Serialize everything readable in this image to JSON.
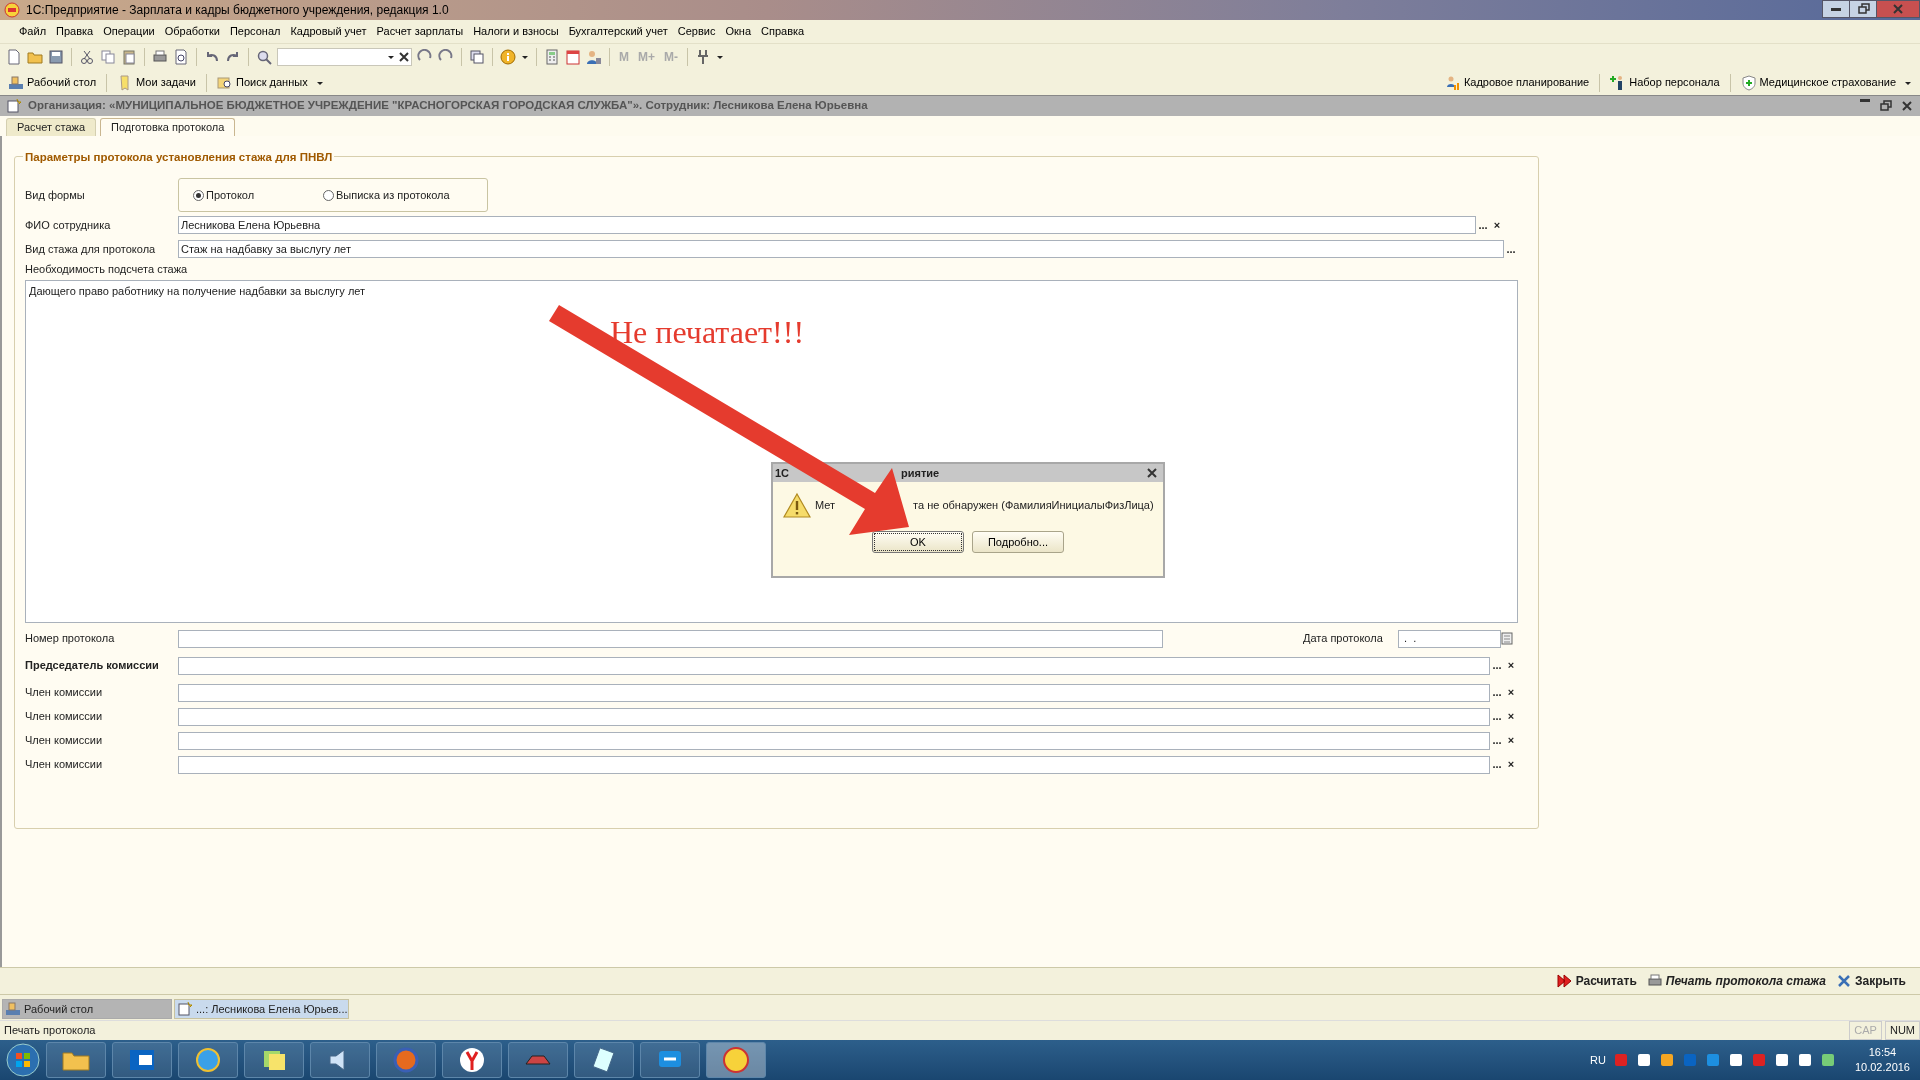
{
  "window": {
    "title": "1С:Предприятие - Зарплата и кадры бюджетного учреждения, редакция 1.0"
  },
  "menu": [
    "Файл",
    "Правка",
    "Операции",
    "Обработки",
    "Персонал",
    "Кадровый учет",
    "Расчет зарплаты",
    "Налоги и взносы",
    "Бухгалтерский учет",
    "Сервис",
    "Окна",
    "Справка"
  ],
  "memory_buttons": [
    {
      "label": "M",
      "disabled": true
    },
    {
      "label": "M+",
      "disabled": true
    },
    {
      "label": "M-",
      "disabled": true
    }
  ],
  "quick_panel": {
    "left": [
      "Рабочий стол",
      "Мои задачи",
      "Поиск данных"
    ],
    "right": [
      "Кадровое планирование",
      "Набор персонала",
      "Медицинское страхование"
    ]
  },
  "document": {
    "title": "Организация: «МУНИЦИПАЛЬНОЕ БЮДЖЕТНОЕ УЧРЕЖДЕНИЕ \"КРАСНОГОРСКАЯ ГОРОДСКАЯ СЛУЖБА\"». Сотрудник: Лесникова Елена Юрьевна",
    "tabs": [
      {
        "label": "Расчет стажа",
        "selected": false
      },
      {
        "label": "Подготовка протокола",
        "selected": true
      }
    ]
  },
  "form": {
    "group_title": "Параметры протокола установления стажа для ПНВЛ",
    "form_type": {
      "label": "Вид формы",
      "options": [
        {
          "label": "Протокол",
          "selected": true
        },
        {
          "label": "Выписка из протокола",
          "selected": false
        }
      ]
    },
    "fields": [
      {
        "label": "ФИО сотрудника",
        "value": "Лесникова Елена Юрьевна",
        "buttons": [
          "...",
          "×"
        ]
      },
      {
        "label": "Вид стажа для протокола",
        "value": "Стаж на надбавку за выслугу лет",
        "buttons": [
          "..."
        ]
      }
    ],
    "need_label": "Необходимость подсчета стажа",
    "need_text": "Дающего право работнику на получение надбавки за выслугу лет",
    "protocol_number": {
      "label": "Номер протокола"
    },
    "protocol_date": {
      "label": "Дата протокола",
      "value": " .  ."
    },
    "commission": [
      {
        "label": "Председатель комиссии",
        "bold": true,
        "buttons": [
          "...",
          "×"
        ]
      },
      {
        "label": "Член комиссии",
        "bold": false,
        "buttons": [
          "...",
          "×"
        ]
      },
      {
        "label": "Член комиссии",
        "bold": false,
        "buttons": [
          "...",
          "×"
        ]
      },
      {
        "label": "Член комиссии",
        "bold": false,
        "buttons": [
          "...",
          "×"
        ]
      },
      {
        "label": "Член комиссии",
        "bold": false,
        "buttons": [
          "...",
          "×"
        ]
      }
    ]
  },
  "actions": [
    {
      "label": "Расчитать",
      "kind": "calc",
      "default": false
    },
    {
      "label": "Печать протокола стажа",
      "kind": "print",
      "default": true
    },
    {
      "label": "Закрыть",
      "kind": "close",
      "default": false
    }
  ],
  "window_tabs": [
    {
      "label": "Рабочий стол",
      "selected": false
    },
    {
      "label": "...: Лесникова Елена Юрьев...",
      "selected": true
    }
  ],
  "status_bar": {
    "text": "Печать протокола",
    "indicators": [
      {
        "label": "CAP",
        "on": false
      },
      {
        "label": "NUM",
        "on": true
      }
    ]
  },
  "dialog": {
    "title_parts": [
      "1С",
      "риятие"
    ],
    "message_parts": [
      "Мет",
      "та не обнаружен (ФамилияИнициалыФизЛица)"
    ],
    "buttons": [
      {
        "label": "OK",
        "default": true
      },
      {
        "label": "Подробно...",
        "default": false
      }
    ]
  },
  "annotation": {
    "text": "Не печатает!!!"
  },
  "taskbar": {
    "language": "RU",
    "time": "16:54",
    "date": "10.02.2016"
  }
}
